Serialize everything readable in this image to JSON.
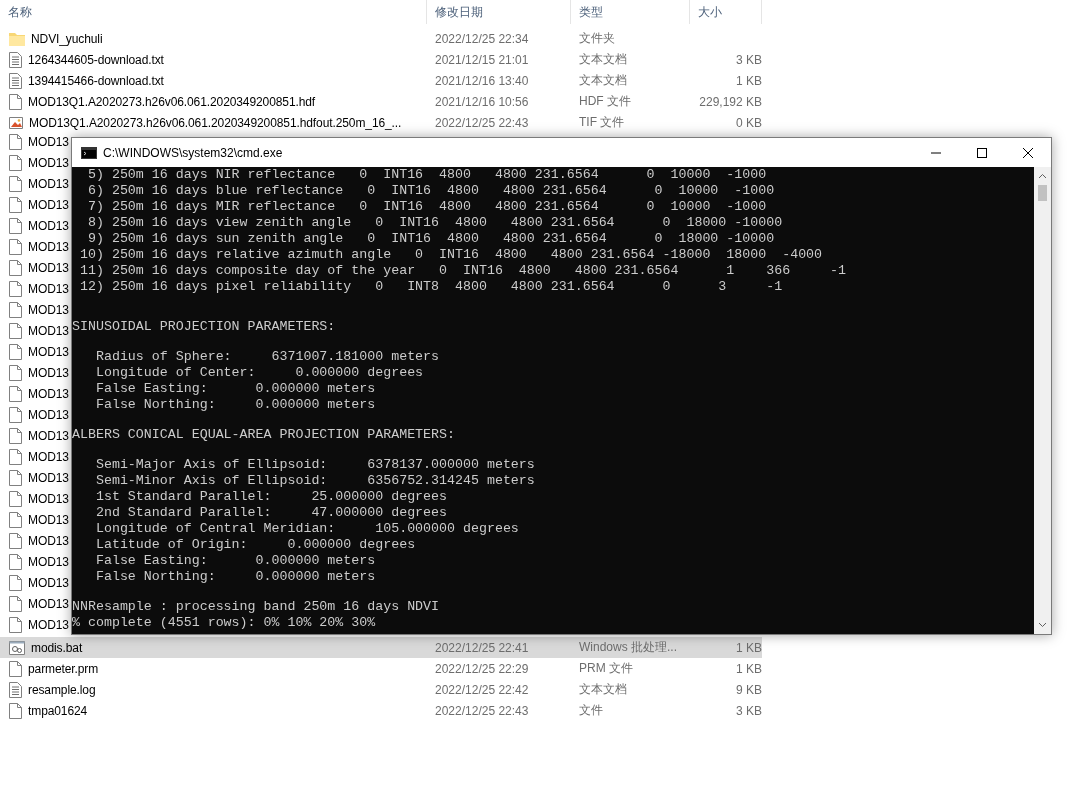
{
  "explorer": {
    "columns": [
      "名称",
      "修改日期",
      "类型",
      "大小"
    ],
    "files": [
      {
        "kind": "folder",
        "name": "NDVI_yuchuli",
        "date": "2022/12/25 22:34",
        "type": "文件夹",
        "selected": false
      },
      {
        "kind": "text",
        "name": "1264344605-download.txt",
        "date": "2021/12/15 21:01",
        "type": "文本文档",
        "size": "3 KB",
        "selected": false
      },
      {
        "kind": "text",
        "name": "1394415466-download.txt",
        "date": "2021/12/16 13:40",
        "type": "文本文档",
        "size": "1 KB",
        "selected": false
      },
      {
        "kind": "file",
        "name": "MOD13Q1.A2020273.h26v06.061.2020349200851.hdf",
        "date": "2021/12/16 10:56",
        "type": "HDF 文件",
        "size": "229,192 KB",
        "selected": false
      },
      {
        "kind": "image",
        "name": "MOD13Q1.A2020273.h26v06.061.2020349200851.hdfout.250m_16_...",
        "date": "2022/12/25 22:43",
        "type": "TIF 文件",
        "size": "0 KB",
        "selected": false
      },
      {
        "kind": "file",
        "name": "MOD13",
        "selected": false
      },
      {
        "kind": "file",
        "name": "MOD13",
        "selected": false
      },
      {
        "kind": "file",
        "name": "MOD13",
        "selected": false
      },
      {
        "kind": "file",
        "name": "MOD13",
        "selected": false
      },
      {
        "kind": "file",
        "name": "MOD13",
        "selected": false
      },
      {
        "kind": "file",
        "name": "MOD13",
        "selected": false
      },
      {
        "kind": "file",
        "name": "MOD13",
        "selected": false
      },
      {
        "kind": "file",
        "name": "MOD13",
        "selected": false
      },
      {
        "kind": "file",
        "name": "MOD13",
        "selected": false
      },
      {
        "kind": "file",
        "name": "MOD13",
        "selected": false
      },
      {
        "kind": "file",
        "name": "MOD13",
        "selected": false
      },
      {
        "kind": "file",
        "name": "MOD13",
        "selected": false
      },
      {
        "kind": "file",
        "name": "MOD13",
        "selected": false
      },
      {
        "kind": "file",
        "name": "MOD13",
        "selected": false
      },
      {
        "kind": "file",
        "name": "MOD13",
        "selected": false
      },
      {
        "kind": "file",
        "name": "MOD13",
        "selected": false
      },
      {
        "kind": "file",
        "name": "MOD13",
        "selected": false
      },
      {
        "kind": "file",
        "name": "MOD13",
        "selected": false
      },
      {
        "kind": "file",
        "name": "MOD13",
        "selected": false
      },
      {
        "kind": "file",
        "name": "MOD13",
        "selected": false
      },
      {
        "kind": "file",
        "name": "MOD13",
        "selected": false
      },
      {
        "kind": "file",
        "name": "MOD13",
        "selected": false
      },
      {
        "kind": "file",
        "name": "MOD13",
        "selected": false
      },
      {
        "kind": "file",
        "name": "MOD13",
        "selected": false
      },
      {
        "kind": "script",
        "name": "modis.bat",
        "date": "2022/12/25 22:41",
        "type": "Windows 批处理...",
        "size": "1 KB",
        "selected": true
      },
      {
        "kind": "file",
        "name": "parmeter.prm",
        "date": "2022/12/25 22:29",
        "type": "PRM 文件",
        "size": "1 KB",
        "selected": false
      },
      {
        "kind": "text",
        "name": "resample.log",
        "date": "2022/12/25 22:42",
        "type": "文本文档",
        "size": "9 KB",
        "selected": false
      },
      {
        "kind": "file",
        "name": "tmpa01624",
        "date": "2022/12/25 22:43",
        "type": "文件",
        "size": "3 KB",
        "selected": false
      }
    ]
  },
  "console_window": {
    "title": "C:\\WINDOWS\\system32\\cmd.exe",
    "blocks": [
      {
        "kind": "table",
        "lines": [
          "  5) 250m 16 days NIR reflectance   0  INT16  4800   4800 231.6564      0  10000  -1000",
          "  6) 250m 16 days blue reflectance   0  INT16  4800   4800 231.6564      0  10000  -1000",
          "  7) 250m 16 days MIR reflectance   0  INT16  4800   4800 231.6564      0  10000  -1000",
          "  8) 250m 16 days view zenith angle   0  INT16  4800   4800 231.6564      0  18000 -10000",
          "  9) 250m 16 days sun zenith angle   0  INT16  4800   4800 231.6564      0  18000 -10000",
          " 10) 250m 16 days relative azimuth angle   0  INT16  4800   4800 231.6564 -18000  18000  -4000",
          " 11) 250m 16 days composite day of the year   0  INT16  4800   4800 231.6564      1    366     -1",
          " 12) 250m 16 days pixel reliability   0   INT8  4800   4800 231.6564      0      3     -1"
        ]
      },
      {
        "kind": "heading",
        "lines": [
          "SINUSOIDAL PROJECTION PARAMETERS:"
        ]
      },
      {
        "kind": "params",
        "lines": [
          "   Radius of Sphere:     6371007.181000 meters",
          "   Longitude of Center:     0.000000 degrees",
          "   False Easting:      0.000000 meters",
          "   False Northing:     0.000000 meters"
        ]
      },
      {
        "kind": "heading",
        "lines": [
          "ALBERS CONICAL EQUAL-AREA PROJECTION PARAMETERS:"
        ]
      },
      {
        "kind": "params",
        "lines": [
          "   Semi-Major Axis of Ellipsoid:     6378137.000000 meters",
          "   Semi-Minor Axis of Ellipsoid:     6356752.314245 meters",
          "   1st Standard Parallel:     25.000000 degrees",
          "   2nd Standard Parallel:     47.000000 degrees",
          "   Longitude of Central Meridian:     105.000000 degrees",
          "   Latitude of Origin:     0.000000 degrees",
          "   False Easting:      0.000000 meters",
          "   False Northing:     0.000000 meters"
        ]
      },
      {
        "kind": "progress",
        "lines": [
          "NNResample : processing band 250m 16 days NDVI",
          "% complete (4551 rows): 0% 10% 20% 30%"
        ]
      }
    ]
  }
}
